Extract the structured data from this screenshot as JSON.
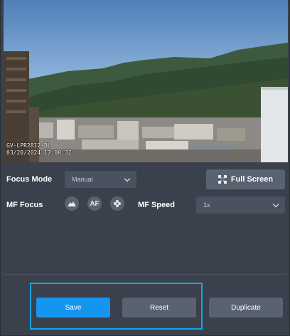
{
  "camera": {
    "overlay_model": "GV-LPR2812-DL",
    "overlay_timestamp": "03/20/2024  17:00:32"
  },
  "controls": {
    "focus_mode_label": "Focus Mode",
    "focus_mode_value": "Manual",
    "full_screen_label": "Full Screen",
    "mf_focus_label": "MF Focus",
    "af_label": "AF",
    "mf_speed_label": "MF Speed",
    "mf_speed_value": "1x"
  },
  "actions": {
    "save_label": "Save",
    "reset_label": "Reset",
    "duplicate_label": "Duplicate"
  },
  "colors": {
    "background": "#3b414c",
    "primary_button": "#1496f0",
    "secondary_button": "#596270",
    "highlight_border": "#1aa3e8"
  },
  "icons": {
    "full_screen": "expand-icon",
    "near_focus": "mountain-icon",
    "far_focus": "flower-icon",
    "dropdown": "chevron-down-icon"
  }
}
